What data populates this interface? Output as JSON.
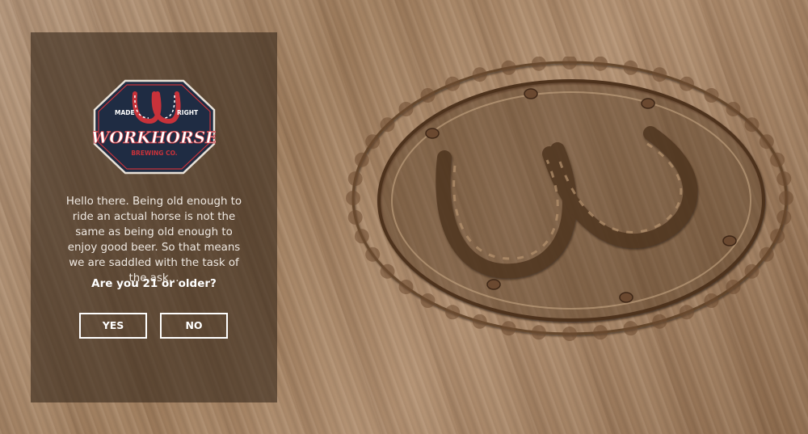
{
  "brand": {
    "name": "WORKHORSE",
    "sub": "BREWING CO.",
    "left_tag": "MADE",
    "right_tag": "RIGHT"
  },
  "age_gate": {
    "message": "Hello there. Being old enough to ride an actual horse is not the same as being old enough to enjoy good beer. So that means we are saddled with the task of the ask...",
    "question": "Are you 21 or older?",
    "yes_label": "YES",
    "no_label": "NO"
  },
  "colors": {
    "panel": "#37281c",
    "badge_navy": "#1f2c43",
    "badge_red": "#c8323a",
    "text": "#ffffff"
  },
  "icons": {
    "background": "horseshoe-emblem-icon"
  }
}
